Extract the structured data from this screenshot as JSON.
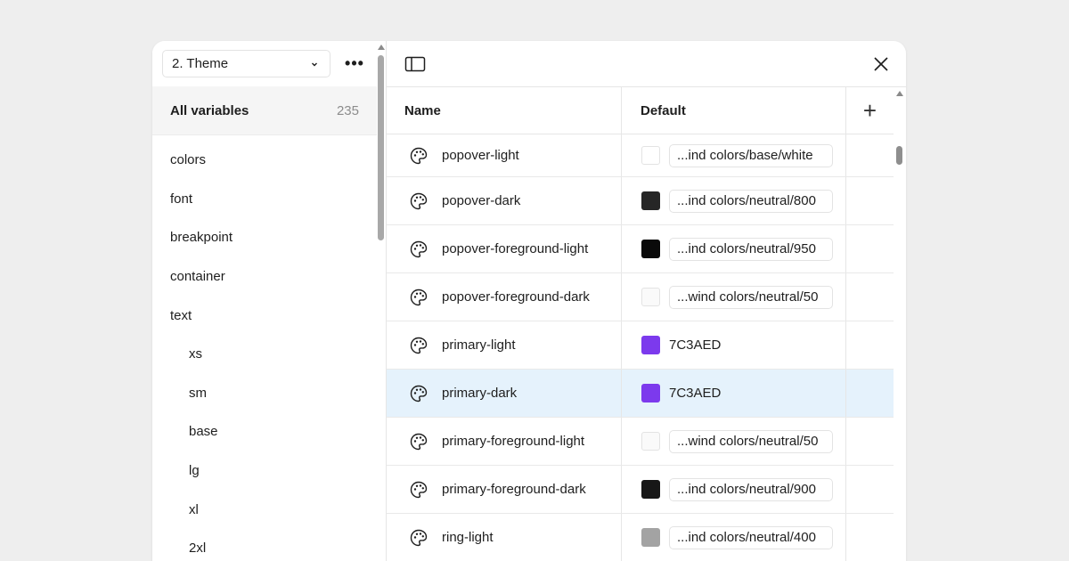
{
  "sidebar": {
    "collection": "2. Theme",
    "more_label": "•••",
    "all_variables": {
      "label": "All variables",
      "count": "235"
    },
    "groups": [
      {
        "label": "colors",
        "sub": false
      },
      {
        "label": "font",
        "sub": false
      },
      {
        "label": "breakpoint",
        "sub": false
      },
      {
        "label": "container",
        "sub": false
      },
      {
        "label": "text",
        "sub": false
      },
      {
        "label": "xs",
        "sub": true
      },
      {
        "label": "sm",
        "sub": true
      },
      {
        "label": "base",
        "sub": true
      },
      {
        "label": "lg",
        "sub": true
      },
      {
        "label": "xl",
        "sub": true
      },
      {
        "label": "2xl",
        "sub": true
      }
    ]
  },
  "table": {
    "headers": {
      "name": "Name",
      "default": "Default",
      "add": "+"
    },
    "rows": [
      {
        "name": "popover-light",
        "swatch": "#ffffff",
        "value": "...ind colors/base/white",
        "kind": "alias",
        "selected": false
      },
      {
        "name": "popover-dark",
        "swatch": "#262626",
        "value": "...ind colors/neutral/800",
        "kind": "alias",
        "selected": false
      },
      {
        "name": "popover-foreground-light",
        "swatch": "#0a0a0a",
        "value": "...ind colors/neutral/950",
        "kind": "alias",
        "selected": false
      },
      {
        "name": "popover-foreground-dark",
        "swatch": "#fafafa",
        "value": "...wind colors/neutral/50",
        "kind": "alias",
        "selected": false
      },
      {
        "name": "primary-light",
        "swatch": "#7c3aed",
        "value": "7C3AED",
        "kind": "hex",
        "selected": false
      },
      {
        "name": "primary-dark",
        "swatch": "#7c3aed",
        "value": "7C3AED",
        "kind": "hex",
        "selected": true
      },
      {
        "name": "primary-foreground-light",
        "swatch": "#fafafa",
        "value": "...wind colors/neutral/50",
        "kind": "alias",
        "selected": false
      },
      {
        "name": "primary-foreground-dark",
        "swatch": "#171717",
        "value": "...ind colors/neutral/900",
        "kind": "alias",
        "selected": false
      },
      {
        "name": "ring-light",
        "swatch": "#a3a3a3",
        "value": "...ind colors/neutral/400",
        "kind": "alias",
        "selected": false
      }
    ]
  },
  "icons": {
    "panel_toggle": "sidebar-panel-icon",
    "close": "close-icon",
    "row": "palette-icon",
    "chevron": "chevron-down-icon"
  },
  "colors": {
    "selected_row": "#e5f2fc",
    "background": "#eeeeee"
  }
}
